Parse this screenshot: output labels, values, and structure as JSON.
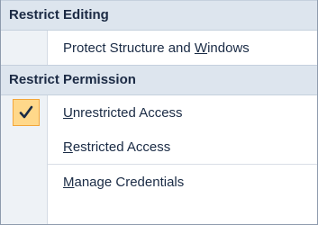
{
  "menu": {
    "restrict_editing": {
      "header": "Restrict Editing",
      "items": [
        {
          "before": "Protect Structure and ",
          "mnemonic": "W",
          "after": "indows"
        }
      ]
    },
    "restrict_permission": {
      "header": "Restrict Permission",
      "items": [
        {
          "before": "",
          "mnemonic": "U",
          "after": "nrestricted Access",
          "checked": true
        },
        {
          "before": "",
          "mnemonic": "R",
          "after": "estricted Access",
          "checked": false
        },
        {
          "before": "",
          "mnemonic": "M",
          "after": "anage Credentials",
          "checked": false
        }
      ]
    }
  },
  "icons": {
    "check": "checkmark-icon"
  },
  "colors": {
    "header_bg": "#dde5ee",
    "gutter_bg": "#eef2f6",
    "check_bg": "#ffd88a",
    "check_border": "#f2a63a",
    "check_mark": "#1a2b45"
  }
}
